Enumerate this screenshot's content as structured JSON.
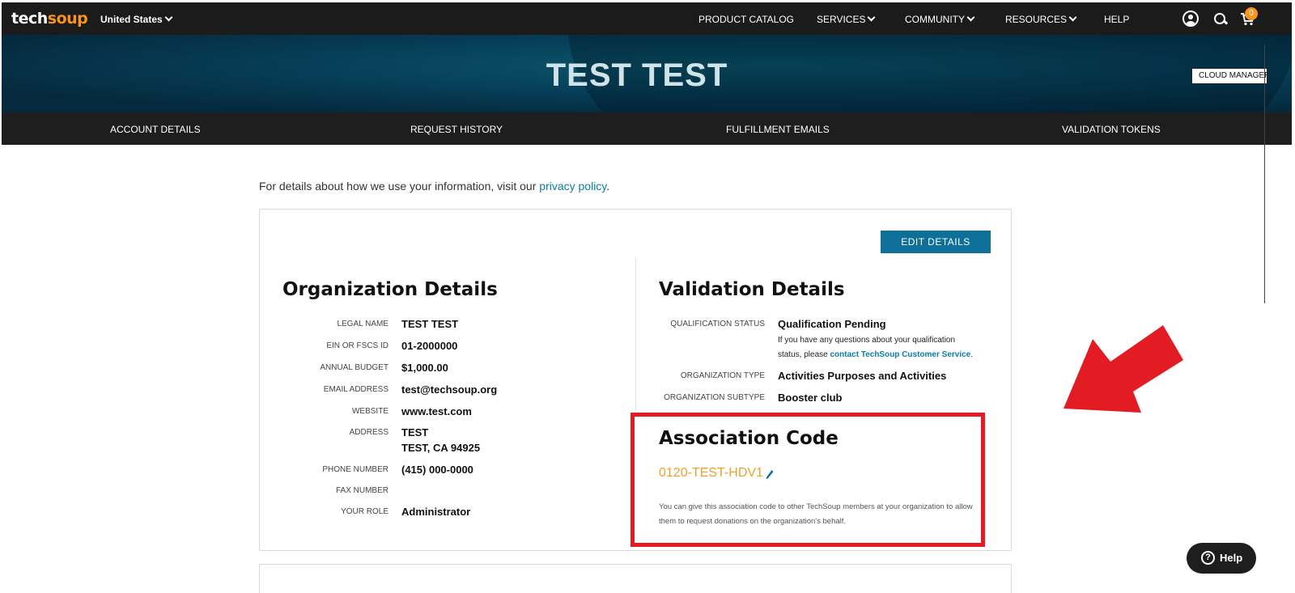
{
  "header": {
    "logo_prefix": "tech",
    "logo_suffix": "soup",
    "region": "United States",
    "nav": [
      {
        "label": "PRODUCT CATALOG"
      },
      {
        "label": "SERVICES"
      },
      {
        "label": "COMMUNITY"
      },
      {
        "label": "RESOURCES"
      },
      {
        "label": "HELP"
      }
    ],
    "cart_count": "0"
  },
  "banner": {
    "title": "TEST TEST",
    "cloud_manager": "CLOUD MANAGER"
  },
  "tabs": [
    {
      "label": "ACCOUNT DETAILS"
    },
    {
      "label": "REQUEST HISTORY"
    },
    {
      "label": "FULFILLMENT EMAILS"
    },
    {
      "label": "VALIDATION TOKENS"
    }
  ],
  "privacy": {
    "text": "For details about how we use your information, visit our ",
    "link": "privacy policy",
    "end": "."
  },
  "edit_button": "EDIT DETAILS",
  "organization": {
    "title": "Organization Details",
    "rows": [
      {
        "label": "LEGAL NAME",
        "value": "TEST TEST"
      },
      {
        "label": "EIN OR FSCS ID",
        "value": "01-2000000"
      },
      {
        "label": "ANNUAL BUDGET",
        "value": "$1,000.00"
      },
      {
        "label": "EMAIL ADDRESS",
        "value": "test@techsoup.org"
      },
      {
        "label": "WEBSITE",
        "value": "www.test.com"
      },
      {
        "label": "ADDRESS",
        "value": "TEST",
        "value2": "TEST, CA 94925"
      },
      {
        "label": "PHONE NUMBER",
        "value": "(415) 000-0000"
      },
      {
        "label": "FAX NUMBER",
        "value": ""
      },
      {
        "label": "YOUR ROLE",
        "value": "Administrator"
      }
    ]
  },
  "validation": {
    "title": "Validation Details",
    "status_label": "QUALIFICATION STATUS",
    "status_value": "Qualification Pending",
    "status_note_1": "If you have any questions about your qualification",
    "status_note_2": "status, please ",
    "status_note_link": "contact TechSoup Customer Service",
    "status_note_end": ".",
    "org_type_label": "ORGANIZATION TYPE",
    "org_type_value": "Activities Purposes and Activities",
    "org_subtype_label": "ORGANIZATION SUBTYPE",
    "org_subtype_value": "Booster club"
  },
  "association": {
    "title": "Association Code",
    "code": "0120-TEST-HDV1",
    "description": "You can give this association code to other TechSoup members at your organization to allow them to request donations on the organization's behalf."
  },
  "help_button": "Help",
  "colors": {
    "accent": "#0e6f99",
    "highlight": "#e31b23",
    "code": "#f0a12a",
    "brand": "#f7941d"
  }
}
